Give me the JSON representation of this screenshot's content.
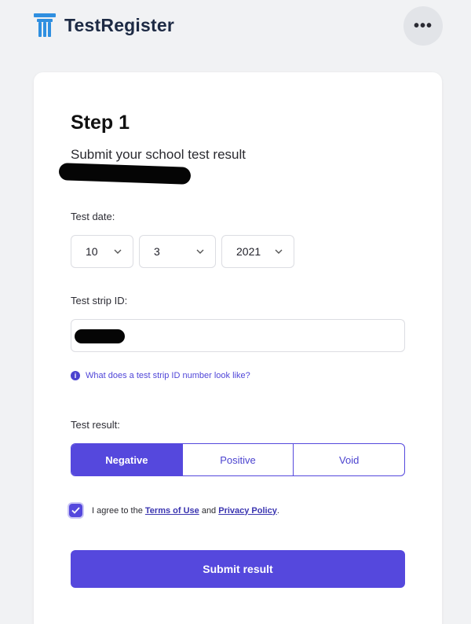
{
  "app": {
    "name": "TestRegister",
    "brand_color": "#1d2a44",
    "logo_color": "#2f8fe0",
    "more_label": "•••"
  },
  "step": {
    "title": "Step 1",
    "subtitle": "Submit your school test result"
  },
  "test_date": {
    "label": "Test date:",
    "day": "10",
    "month": "3",
    "year": "2021"
  },
  "test_strip": {
    "label": "Test strip ID:",
    "value": ""
  },
  "help": {
    "icon": "info-icon",
    "text": "What does a test strip ID number look like?"
  },
  "test_result": {
    "label": "Test result:",
    "options": [
      "Negative",
      "Positive",
      "Void"
    ],
    "selected": "Negative"
  },
  "agreement": {
    "checked": true,
    "prefix": "I agree to the ",
    "terms": "Terms of Use",
    "middle": " and ",
    "privacy": "Privacy Policy",
    "suffix": "."
  },
  "submit": {
    "label": "Submit result"
  },
  "colors": {
    "accent": "#5548dd",
    "background": "#f1f2f4",
    "card": "#ffffff"
  }
}
